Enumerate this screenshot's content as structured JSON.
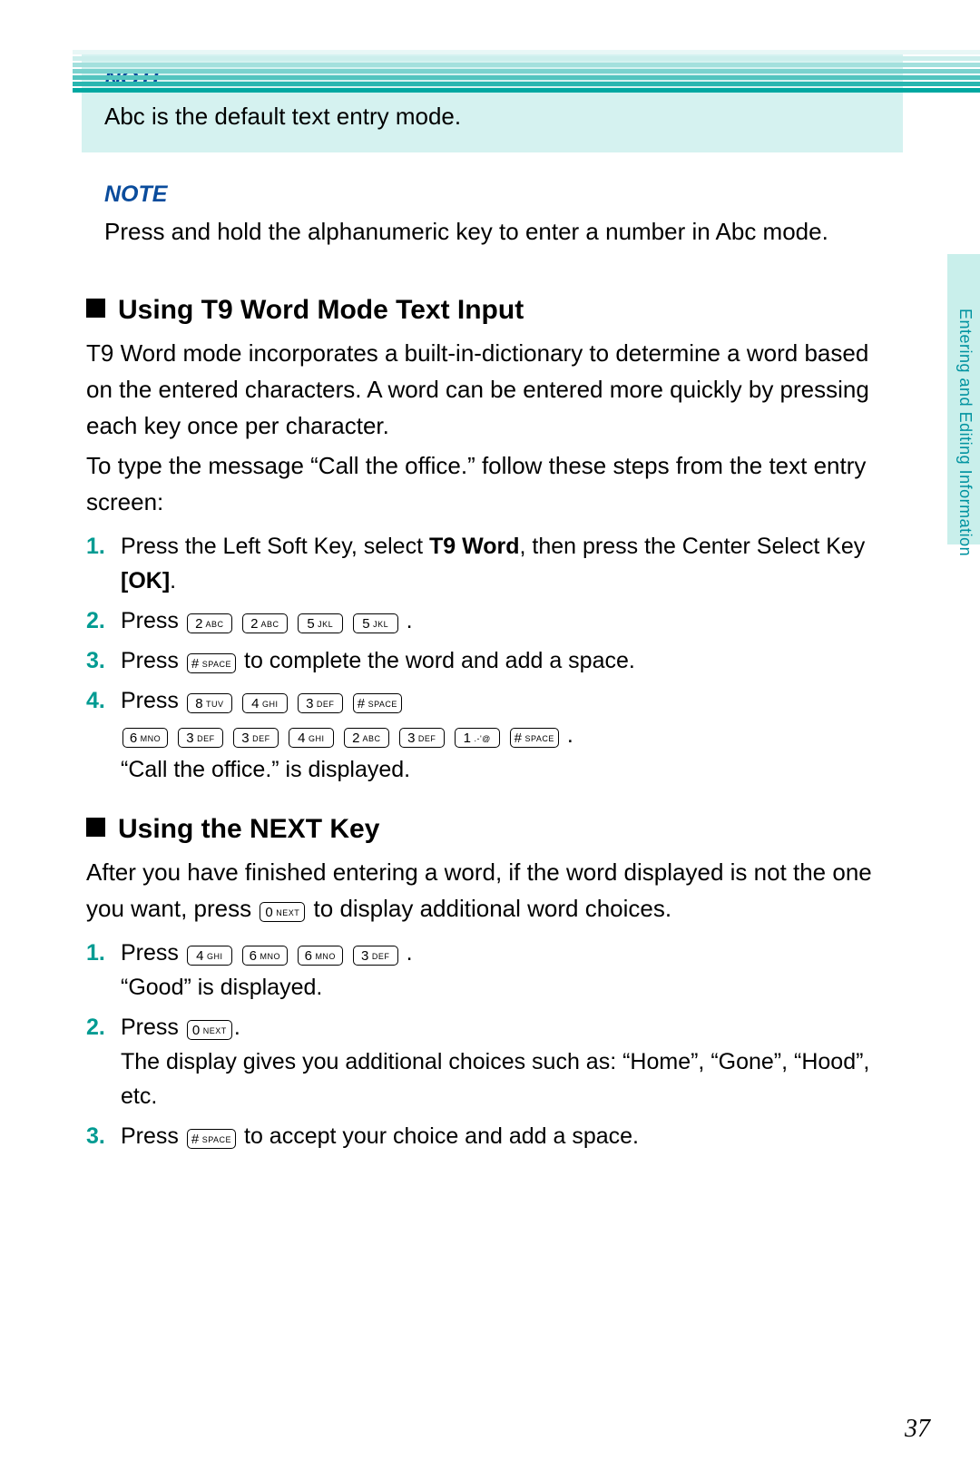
{
  "sideTab": "Entering and Editing Information",
  "pageNumber": "37",
  "note1": {
    "title": "NOTE",
    "body": "Abc is the default text entry mode."
  },
  "note2": {
    "title": "NOTE",
    "body": "Press and hold the alphanumeric key to enter a number in Abc mode."
  },
  "section1": {
    "heading": "Using T9 Word Mode Text Input",
    "para1": "T9 Word mode incorporates a built-in-dictionary to determine a word based on the entered characters. A word can be entered more quickly by pressing each key once per character.",
    "para2": "To type the message “Call the office.” follow these steps from the text entry screen:",
    "steps": {
      "s1a": "Press the Left Soft Key, select ",
      "s1b": "T9 Word",
      "s1c": ", then press the Center Select Key ",
      "s1d": "[OK]",
      "s1e": ".",
      "s2a": "Press ",
      "s2keys": [
        "2 ABC",
        "2 ABC",
        "5 JKL",
        "5 JKL"
      ],
      "s2b": ".",
      "s3a": "Press ",
      "s3key": "# SPACE",
      "s3b": " to complete the word and add a space.",
      "s4a": "Press ",
      "s4keys1": [
        "8 TUV",
        "4 GHI",
        "3 DEF",
        "# SPACE"
      ],
      "s4keys2": [
        "6 MNO",
        "3 DEF",
        "3 DEF",
        "4 GHI",
        "2 ABC",
        "3 DEF",
        "1 .-'@",
        "# SPACE"
      ],
      "s4b": ".",
      "s4c": "“Call the office.” is displayed."
    }
  },
  "section2": {
    "heading": "Using the NEXT Key",
    "para1a": "After you have finished entering a word, if the word displayed is not the one you want, press ",
    "para1key": "0 NEXT",
    "para1b": " to display additional word choices.",
    "steps": {
      "s1a": "Press ",
      "s1keys": [
        "4 GHI",
        "6 MNO",
        "6 MNO",
        "3 DEF"
      ],
      "s1b": ".",
      "s1c": "“Good” is displayed.",
      "s2a": "Press ",
      "s2key": "0 NEXT",
      "s2b": ".",
      "s2c": "The display gives you additional choices such as: “Home”, “Gone”, “Hood”, etc.",
      "s3a": "Press ",
      "s3key": "# SPACE",
      "s3b": " to accept your choice and add a space."
    }
  }
}
